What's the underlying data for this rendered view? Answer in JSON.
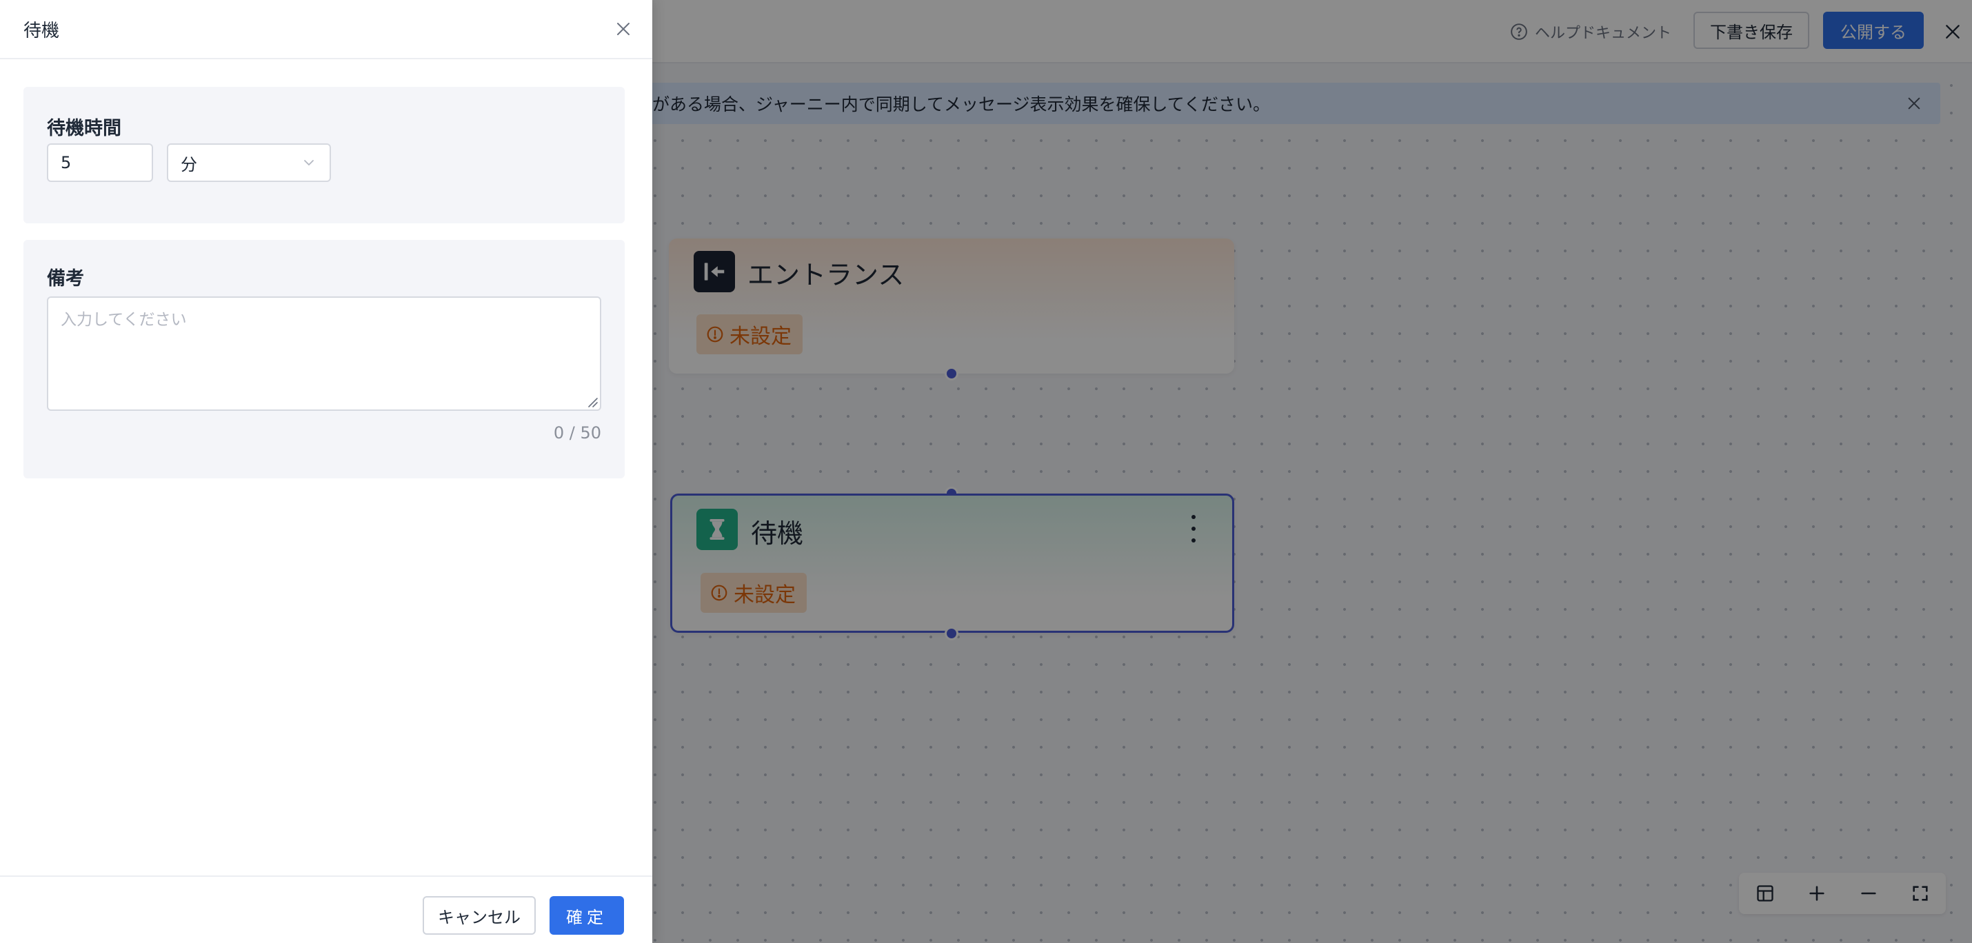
{
  "header": {
    "help_label": "ヘルプドキュメント",
    "save_draft_label": "下書き保存",
    "publish_label": "公開する"
  },
  "notice": {
    "text": "がある場合、ジャーニー内で同期してメッセージ表示効果を確保してください。"
  },
  "canvas": {
    "nodes": [
      {
        "title": "エントランス",
        "status": "未設定"
      },
      {
        "title": "待機",
        "status": "未設定"
      }
    ]
  },
  "drawer": {
    "title": "待機",
    "wait": {
      "label": "待機時間",
      "value": "5",
      "unit": "分"
    },
    "note": {
      "label": "備考",
      "placeholder": "入力してください",
      "value": "",
      "char_count": "0 / 50"
    },
    "footer": {
      "cancel_label": "キャンセル",
      "ok_label": "確定"
    }
  },
  "colors": {
    "primary": "#2f6fe8",
    "node_selected_border": "#4b5bd6",
    "status_warning": "#e0650f",
    "entrance_icon_bg": "#1d2433",
    "wait_icon_bg": "#23b38a"
  }
}
